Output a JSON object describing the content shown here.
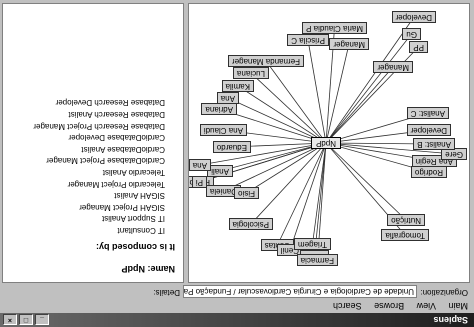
{
  "window": {
    "title": "Sapiens",
    "buttons": [
      "_",
      "□",
      "×"
    ]
  },
  "menu": [
    "Main",
    "View",
    "Browse",
    "Search"
  ],
  "status": {
    "organization_label": "Organization:",
    "organization_value": "Unidade de Cardiologia e Cirurgia Cardiovascular / Fundação Pablo de Cardio",
    "details_label": "Details:"
  },
  "graph": {
    "center": "NpdP",
    "nodes": [
      "Rodrigo",
      "Ana Regin",
      "Gere",
      "Analist: B",
      "Developer",
      "Analist: C",
      "Manager",
      "PP",
      "Gu",
      "Developer",
      "Eduardo",
      "Ana Claudi",
      "Adriana",
      "Ana",
      "Kamila",
      "Luciana",
      "Fernanda Manager",
      "Priscila C",
      "Maria Claudia P",
      "Manager",
      "Anali",
      "Paulo",
      "Ana",
      "Pi",
      "Daniela",
      "Fisio",
      "Psicologia",
      "Contas",
      "Cenil",
      "Unida",
      "Farmacia",
      "Triagem",
      "Tomografia",
      "Nutrição"
    ]
  },
  "details": {
    "name_label": "Name:",
    "name_value": "NpdP",
    "composed_label": "It is composed by:",
    "items": [
      "IT Consultant",
      "IT Support Analist",
      "SIGAH Project Manager",
      "SIGAH Analist",
      "Telecardio Project Manager",
      "Telecardio Analist",
      "CardioDatabase Project Manager",
      "CardioDatabase Analist",
      "CardioDatabase Developer",
      "Database Research Project Manager",
      "Database Research Analist",
      "Database Research Developer"
    ]
  }
}
